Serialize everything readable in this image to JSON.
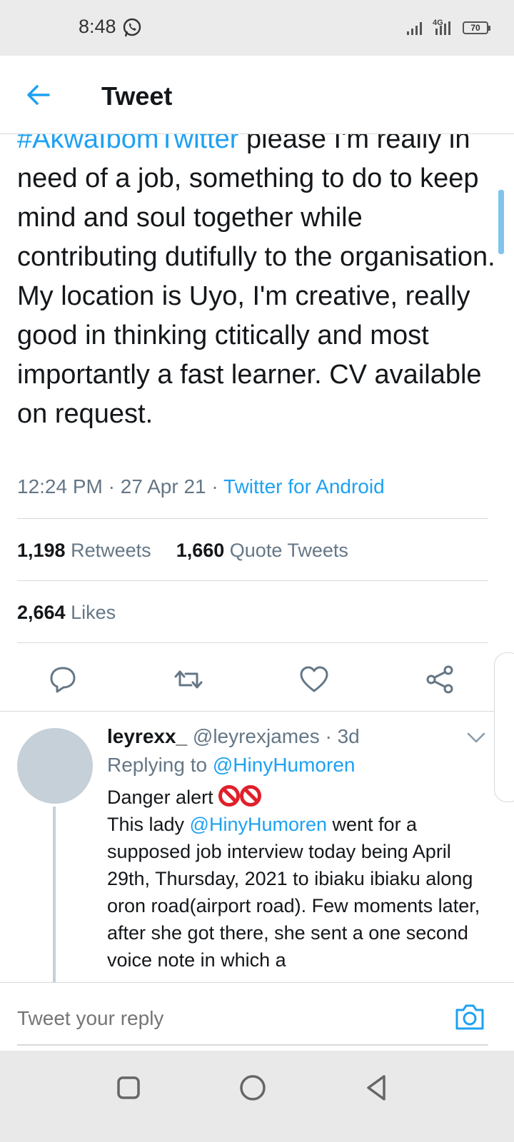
{
  "status_bar": {
    "time": "8:48",
    "network": "4G",
    "battery": "70"
  },
  "header": {
    "title": "Tweet"
  },
  "tweet": {
    "hashtag": "#AkwaIbomTwitter",
    "text": " please I'm really in need of a job, something to do to keep mind and soul together while contributing dutifully to the organisation. My location is Uyo, I'm creative, really good in thinking ctitically and most importantly a fast learner. CV available on request.",
    "time": "12:24 PM",
    "date": "27 Apr 21",
    "source": "Twitter for Android"
  },
  "stats": {
    "retweets_count": "1,198",
    "retweets_label": "Retweets",
    "quotes_count": "1,660",
    "quotes_label": "Quote Tweets",
    "likes_count": "2,664",
    "likes_label": "Likes"
  },
  "reply": {
    "name": "leyrexx_",
    "handle": "@leyrexjames",
    "age": "3d",
    "replying_label": "Replying to",
    "replying_to": "@HinyHumoren",
    "line1": "Danger alert",
    "text_before": "This lady ",
    "mention": "@HinyHumoren",
    "text_after": "  went for a supposed job interview today being April 29th, Thursday, 2021 to ibiaku ibiaku along oron road(airport road). Few moments later, after she got there, she sent a one second voice note in which a"
  },
  "composer": {
    "placeholder": "Tweet your reply"
  },
  "colors": {
    "accent": "#1da1f2",
    "secondary_text": "#657786",
    "danger": "#e0202a"
  }
}
